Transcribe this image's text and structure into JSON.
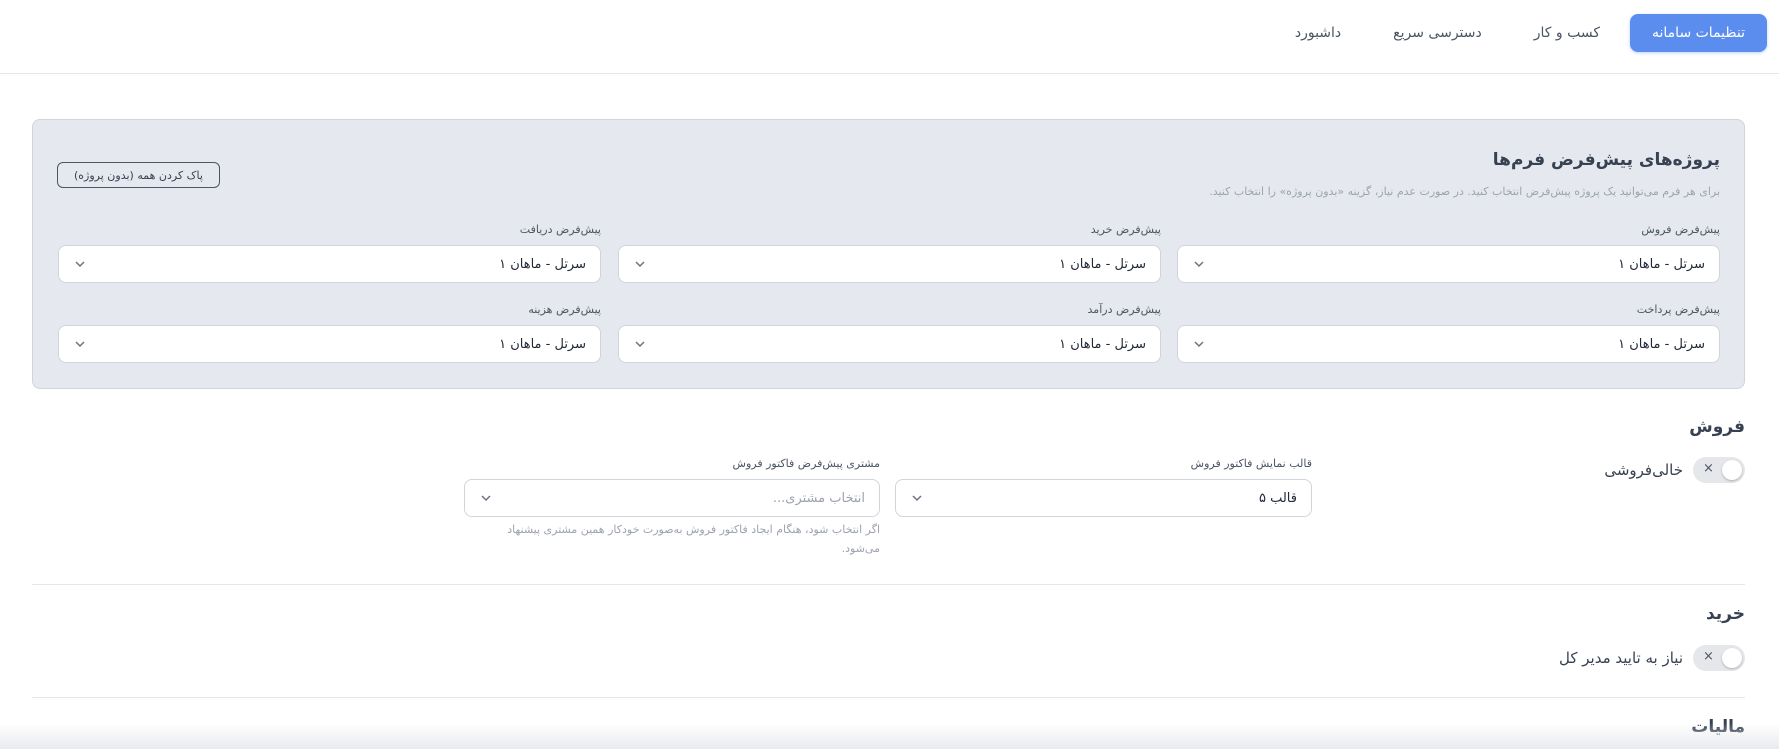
{
  "nav": {
    "tabs": [
      {
        "label": "تنظیمات سامانه",
        "active": true
      },
      {
        "label": "کسب و کار",
        "active": false
      },
      {
        "label": "دسترسی سریع",
        "active": false
      },
      {
        "label": "داشبورد",
        "active": false
      }
    ]
  },
  "projects": {
    "title": "پروژه‌های پیش‌فرض فرم‌ها",
    "subtitle": "برای هر فرم می‌توانید یک پروژه پیش‌فرض انتخاب کنید. در صورت عدم نیاز، گزینه «بدون پروژه» را انتخاب کنید.",
    "clear_label": "پاک کردن همه (بدون پروژه)",
    "fields": [
      {
        "label": "پیش‌فرض فروش",
        "value": "سرتل - ماهان ۱"
      },
      {
        "label": "پیش‌فرض خرید",
        "value": "سرتل - ماهان ۱"
      },
      {
        "label": "پیش‌فرض دریافت",
        "value": "سرتل - ماهان ۱"
      },
      {
        "label": "پیش‌فرض پرداخت",
        "value": "سرتل - ماهان ۱"
      },
      {
        "label": "پیش‌فرض درآمد",
        "value": "سرتل - ماهان ۱"
      },
      {
        "label": "پیش‌فرض هزینه",
        "value": "سرتل - ماهان ۱"
      }
    ]
  },
  "sales": {
    "title": "فروش",
    "toggle_label": "خالی‌فروشی",
    "toggle_symbol": "×",
    "template_label": "قالب نمایش فاکتور فروش",
    "template_value": "قالب ۵",
    "customer_label": "مشتری پیش‌فرض فاکتور فروش",
    "customer_placeholder": "انتخاب مشتری...",
    "customer_help_line1": "اگر انتخاب شود، هنگام ایجاد فاکتور فروش به‌صورت خودکار همین مشتری پیشنهاد",
    "customer_help_line2": "می‌شود."
  },
  "purchase": {
    "title": "خرید",
    "toggle_label": "نیاز به تایید مدیر کل",
    "toggle_symbol": "×"
  },
  "tax": {
    "title": "مالیات"
  },
  "colors": {
    "accent": "#5b8def",
    "card_bg": "#e5e9ef"
  }
}
